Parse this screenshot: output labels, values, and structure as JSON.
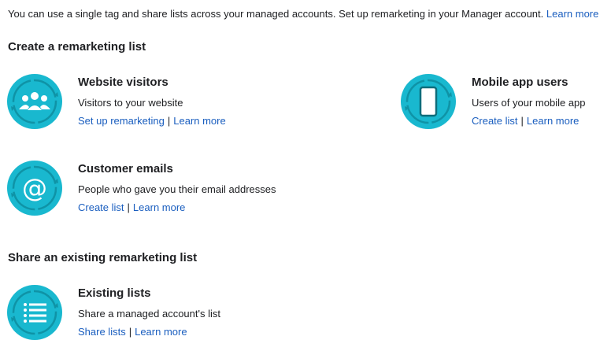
{
  "intro": {
    "text": "You can use a single tag and share lists across your managed accounts. Set up remarketing in your Manager account.",
    "learn_more": "Learn more"
  },
  "create_section": {
    "title": "Create a remarketing list",
    "cards": [
      {
        "title": "Website visitors",
        "description": "Visitors to your website",
        "primary_link": "Set up remarketing",
        "secondary_link": "Learn more",
        "icon": "people-icon"
      },
      {
        "title": "Mobile app users",
        "description": "Users of your mobile app",
        "primary_link": "Create list",
        "secondary_link": "Learn more",
        "icon": "phone-icon"
      },
      {
        "title": "Customer emails",
        "description": "People who gave you their email addresses",
        "primary_link": "Create list",
        "secondary_link": "Learn more",
        "icon": "at-sign-icon"
      }
    ]
  },
  "share_section": {
    "title": "Share an existing remarketing list",
    "cards": [
      {
        "title": "Existing lists",
        "description": "Share a managed account's list",
        "primary_link": "Share lists",
        "secondary_link": "Learn more",
        "icon": "list-icon"
      }
    ]
  },
  "colors": {
    "icon_teal": "#19b8cf",
    "icon_ring": "#12a3b8",
    "link_blue": "#1a5ebf"
  },
  "separator": "|"
}
